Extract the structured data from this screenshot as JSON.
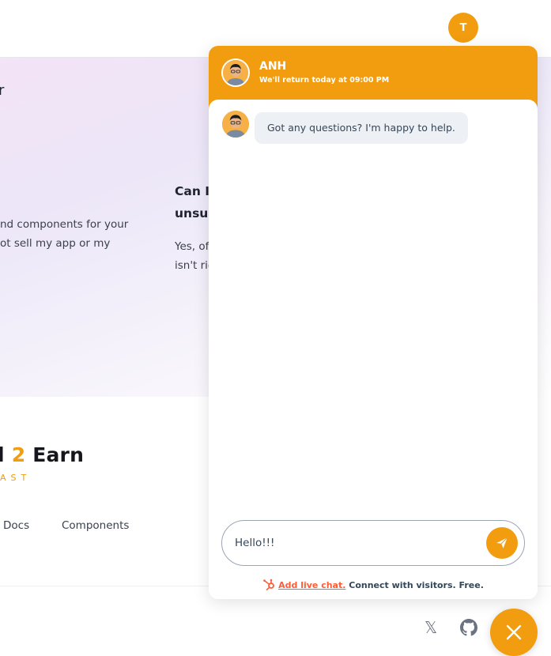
{
  "header": {
    "user_initial": "T"
  },
  "page": {
    "faq_left_partial": "r",
    "faq_left_text_line1": "nd components for your",
    "faq_left_text_line2": "ot sell my app or my",
    "faq_right_title_line1": "Can I",
    "faq_right_title_line2": "unsui",
    "faq_right_text_line1": "Yes, of",
    "faq_right_text_line2": "isn't rig",
    "brand_part1": "l ",
    "brand_accent": "2",
    "brand_part2": " Earn",
    "brand_sub": "AST",
    "footer_links": [
      "Docs",
      "Components"
    ]
  },
  "chat": {
    "agent_name": "ANH",
    "agent_status": "We'll return today at 09:00 PM",
    "messages": [
      {
        "from": "agent",
        "text": "Got any questions? I'm happy to help."
      }
    ],
    "input_value": "Hello!!!",
    "powered_link": "Add live chat.",
    "powered_text": "Connect with visitors. Free."
  },
  "icons": {
    "social": [
      "x-icon",
      "github-icon"
    ],
    "launcher": "close-icon",
    "send": "send-icon"
  },
  "colors": {
    "accent": "#f29c0f",
    "hubspot": "#ff5c35",
    "bubble": "#edf0f4"
  }
}
